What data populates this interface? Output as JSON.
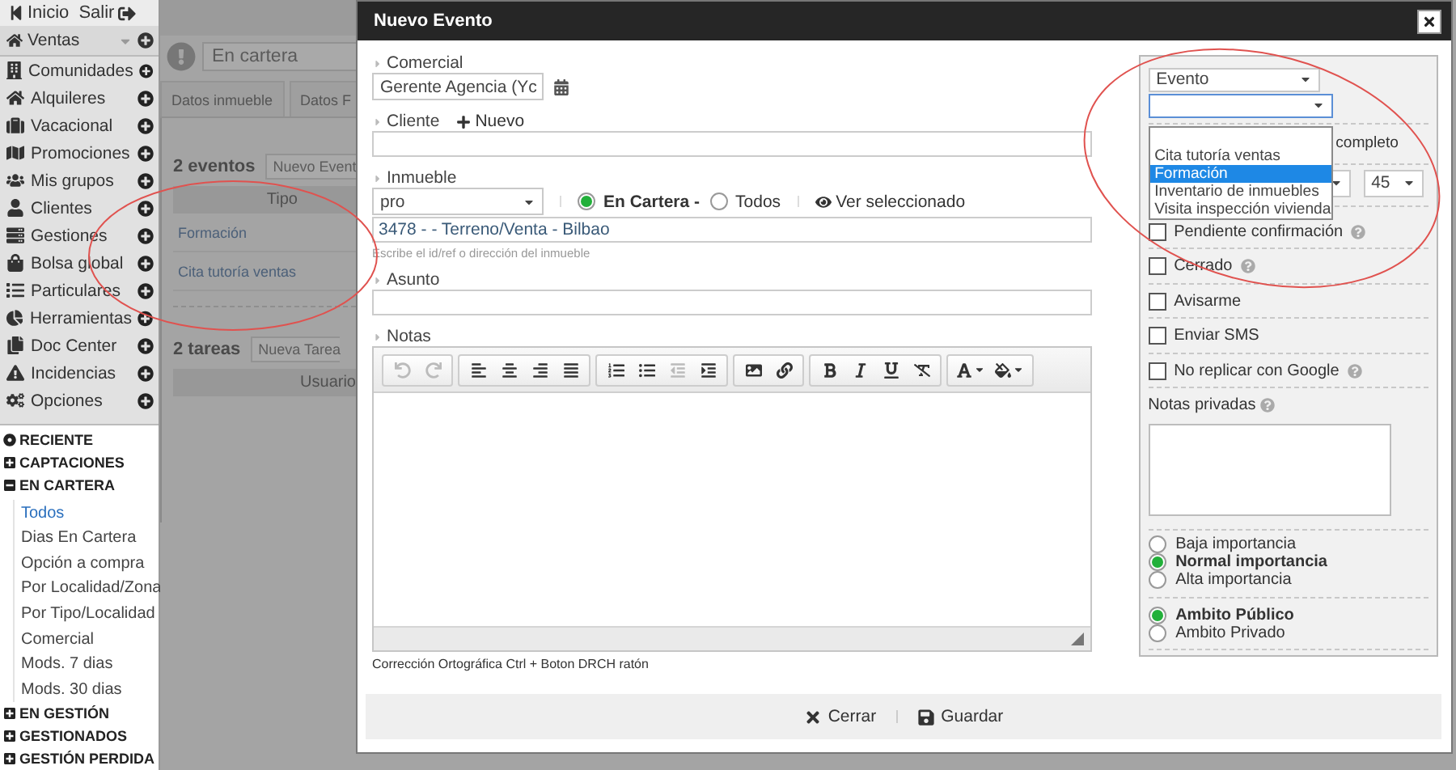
{
  "topbar": {
    "home": "Inicio",
    "logout": "Salir"
  },
  "menu": {
    "section": "Ventas",
    "items": [
      {
        "label": "Comunidades"
      },
      {
        "label": "Alquileres"
      },
      {
        "label": "Vacacional"
      },
      {
        "label": "Promociones"
      },
      {
        "label": "Mis grupos"
      },
      {
        "label": "Clientes"
      },
      {
        "label": "Gestiones"
      },
      {
        "label": "Bolsa global"
      },
      {
        "label": "Particulares"
      },
      {
        "label": "Herramientas"
      },
      {
        "label": "Doc Center"
      },
      {
        "label": "Incidencias"
      },
      {
        "label": "Opciones"
      }
    ]
  },
  "tree": [
    {
      "kind": "recent",
      "label": "RECIENTE"
    },
    {
      "kind": "folder",
      "label": "CAPTACIONES",
      "expanded": false
    },
    {
      "kind": "folder",
      "label": "EN CARTERA",
      "expanded": true,
      "children": [
        {
          "label": "Todos",
          "selected": true
        },
        {
          "label": "Dias En Cartera",
          "selected": false
        },
        {
          "label": "Opción a compra",
          "selected": false
        },
        {
          "label": "Por Localidad/Zona",
          "selected": false
        },
        {
          "label": "Por Tipo/Localidad",
          "selected": false
        },
        {
          "label": "Comercial",
          "selected": false
        },
        {
          "label": "Mods. 7 dias",
          "selected": false
        },
        {
          "label": "Mods. 30 dias",
          "selected": false
        }
      ]
    },
    {
      "kind": "folder",
      "label": "EN GESTIÓN",
      "expanded": false
    },
    {
      "kind": "folder",
      "label": "GESTIONADOS",
      "expanded": false
    },
    {
      "kind": "folder",
      "label": "GESTIÓN PERDIDA",
      "expanded": false
    }
  ],
  "background": {
    "search_value": "En cartera",
    "tabs": [
      "Datos inmueble",
      "Datos F"
    ],
    "events": {
      "count": "2 eventos",
      "button": "Nuevo Event",
      "column": "Tipo",
      "rows": [
        "Formación",
        "Cita tutoría ventas"
      ]
    },
    "tasks": {
      "count": "2 tareas",
      "button": "Nueva Tarea",
      "column": "Usuario"
    }
  },
  "dialog": {
    "title": "Nuevo Evento",
    "comercial": {
      "label": "Comercial",
      "value": "Gerente Agencia (Yc"
    },
    "cliente": {
      "label": "Cliente",
      "new_link": "Nuevo"
    },
    "inmueble": {
      "label": "Inmueble",
      "filter": "pro",
      "scope": [
        {
          "label": "En Cartera -",
          "selected": true
        },
        {
          "label": "Todos",
          "selected": false
        }
      ],
      "view_link": "Ver seleccionado",
      "value": "3478 -  - Terreno/Venta - Bilbao",
      "hint": "Escribe el id/ref o dirección del inmueble"
    },
    "asunto": {
      "label": "Asunto"
    },
    "notas": {
      "label": "Notas",
      "spell_hint": "Corrección Ortográfica Ctrl + Boton DRCH ratón"
    },
    "side": {
      "type_select": "Evento",
      "subtype_options": [
        {
          "label": "Cita tutoría ventas",
          "selected": false
        },
        {
          "label": "Formación",
          "selected": true
        },
        {
          "label": "Inventario de inmuebles",
          "selected": false
        },
        {
          "label": "Visita inspección vivienda",
          "selected": false
        }
      ],
      "all_day": "completo",
      "minutes": "45",
      "checks": [
        {
          "label": "Pendiente confirmación",
          "checked": false,
          "help": true
        },
        {
          "label": "Cerrado",
          "checked": false,
          "help": true
        },
        {
          "label": "Avisarme",
          "checked": false,
          "help": false
        },
        {
          "label": "Enviar SMS",
          "checked": false,
          "help": false
        },
        {
          "label": "No replicar con Google",
          "checked": false,
          "help": true
        }
      ],
      "private_notes": "Notas privadas",
      "importance": [
        {
          "label": "Baja importancia",
          "selected": false
        },
        {
          "label": "Normal importancia",
          "selected": true
        },
        {
          "label": "Alta importancia",
          "selected": false
        }
      ],
      "scope": [
        {
          "label": "Ambito Público",
          "selected": true
        },
        {
          "label": "Ambito Privado",
          "selected": false
        }
      ]
    },
    "footer": {
      "close": "Cerrar",
      "save": "Guardar"
    }
  }
}
